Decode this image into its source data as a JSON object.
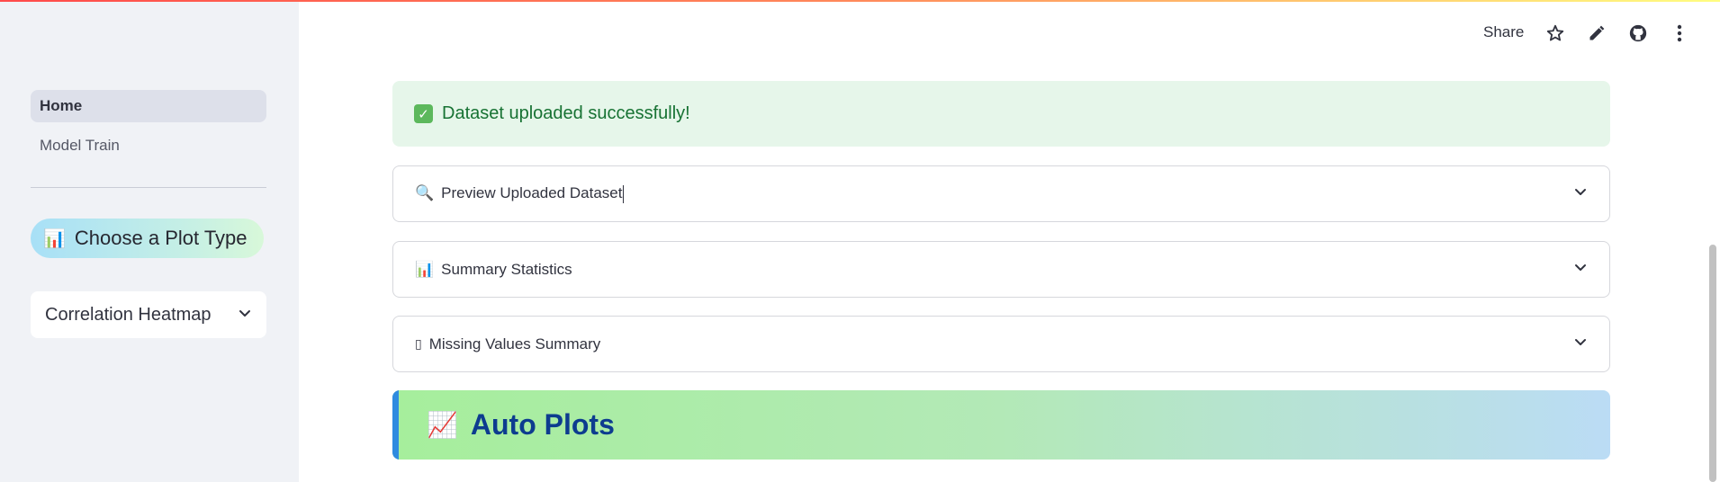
{
  "sidebar": {
    "nav_items": [
      {
        "label": "Home",
        "active": true
      },
      {
        "label": "Model Train",
        "active": false
      }
    ],
    "plot_type_heading": {
      "icon": "bar-chart-emoji",
      "text": "Choose a Plot Type"
    },
    "plot_select": {
      "value": "Correlation Heatmap"
    }
  },
  "header": {
    "share_label": "Share",
    "icons": [
      "star-icon",
      "pencil-icon",
      "github-icon",
      "more-vertical-icon"
    ]
  },
  "main": {
    "success_alert": {
      "icon": "checkmark-emoji",
      "text": "Dataset uploaded successfully!"
    },
    "expanders": [
      {
        "icon": "🔍",
        "label": "Preview Uploaded Dataset"
      },
      {
        "icon": "📊",
        "label": "Summary Statistics"
      },
      {
        "icon": "▯",
        "label": "Missing Values Summary"
      }
    ],
    "auto_plots": {
      "icon": "📈",
      "title": "Auto Plots"
    }
  },
  "colors": {
    "success_bg": "#e6f6ea",
    "success_text": "#177233",
    "auto_plots_accent": "#2f8be0",
    "auto_plots_title": "#0d3c8f"
  }
}
